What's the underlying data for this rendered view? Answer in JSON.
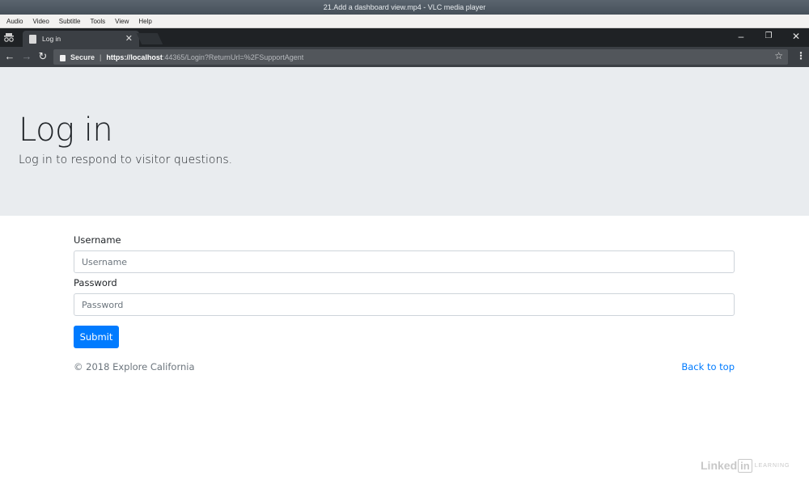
{
  "vlc": {
    "title": "21.Add a dashboard view.mp4 - VLC media player",
    "menu": [
      "Audio",
      "Video",
      "Subtitle",
      "Tools",
      "View",
      "Help"
    ]
  },
  "browser": {
    "tab_title": "Log in",
    "secure_label": "Secure",
    "url_host": "https://localhost",
    "url_rest": ":44365/Login?ReturnUrl=%2FSupportAgent"
  },
  "page": {
    "heading": "Log in",
    "lead": "Log in to respond to visitor questions.",
    "form": {
      "username_label": "Username",
      "username_placeholder": "Username",
      "password_label": "Password",
      "password_placeholder": "Password",
      "submit_label": "Submit"
    },
    "footer": {
      "copyright": "© 2018 Explore California",
      "back_to_top": "Back to top"
    }
  },
  "watermark": {
    "linked": "Linked",
    "in": "in",
    "learning": "LEARNING"
  },
  "colors": {
    "primary": "#007bff",
    "jumbotron_bg": "#e9ecef"
  }
}
